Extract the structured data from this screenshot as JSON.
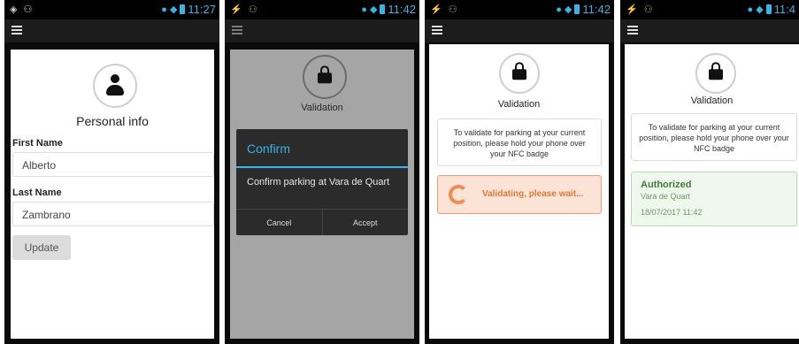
{
  "screens": [
    {
      "status": {
        "left": "◈ ⚇",
        "time": "11:27"
      },
      "avatar_icon": "person-icon",
      "title": "Personal info",
      "first_name": {
        "label": "First Name",
        "value": "Alberto"
      },
      "last_name": {
        "label": "Last Name",
        "value": "Zambrano"
      },
      "update_label": "Update"
    },
    {
      "status": {
        "left": "⚡ ⚇",
        "time": "11:42"
      },
      "title": "Validation",
      "dialog": {
        "title": "Confirm",
        "message": "Confirm parking at Vara de Quart",
        "cancel": "Cancel",
        "accept": "Accept"
      }
    },
    {
      "status": {
        "left": "⚡ ⚇",
        "time": "11:42"
      },
      "title": "Validation",
      "info": "To validate for parking at your current position, please hold your phone over your NFC badge",
      "validating": "Validating, please wait..."
    },
    {
      "status": {
        "left": "⚡ ⚇",
        "time": "11:4"
      },
      "title": "Validation",
      "info": "To validate for parking at your current position, please hold your phone over your NFC badge",
      "authorized": {
        "status": "Authorized",
        "location": "Vara de Quart",
        "datetime": "18/07/2017 11:42"
      }
    }
  ],
  "colors": {
    "accent": "#33b5e5",
    "validating": "#e07838",
    "authorized": "#3e7b36"
  }
}
